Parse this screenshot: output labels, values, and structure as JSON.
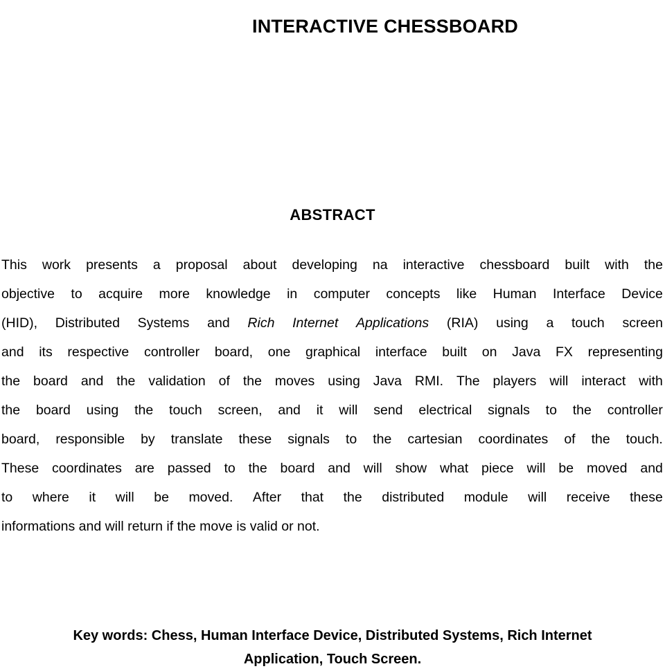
{
  "document": {
    "title": "INTERACTIVE CHESSBOARD",
    "abstract_heading": "ABSTRACT",
    "background_color": "#ffffff",
    "text_color": "#000000"
  },
  "abstract": {
    "lines": [
      {
        "id": "line-1",
        "text": "This work presents a proposal about developing na interactive chessboard built with the",
        "words": [
          "This",
          "work",
          "presents",
          "a",
          "proposal",
          "about",
          "developing",
          "na",
          "interactive",
          "chessboard",
          "built",
          "with",
          "the"
        ]
      },
      {
        "id": "line-2",
        "text": "objective to acquire more knowledge in computer concepts like Human Interface Device",
        "words": [
          "objective",
          "to",
          "acquire",
          "more",
          "knowledge",
          "in",
          "computer",
          "concepts",
          "like",
          "Human",
          "Interface",
          "Device"
        ]
      },
      {
        "id": "line-3",
        "text": "(HID), Distributed Systems and Rich Internet Applications (RIA) using a touch screen",
        "words": [
          "(HID),",
          "Distributed",
          "Systems",
          "and",
          "Rich",
          "Internet",
          "Applications",
          "(RIA)",
          "using",
          "a",
          "touch",
          "screen"
        ],
        "italic_words": [
          "Rich",
          "Internet",
          "Applications"
        ],
        "italic_phrase": "Rich Internet Applications"
      },
      {
        "id": "line-4",
        "text": "and its respective controller board, one graphical interface built on Java FX representing",
        "words": [
          "and",
          "its",
          "respective",
          "controller",
          "board,",
          "one",
          "graphical",
          "interface",
          "built",
          "on",
          "Java",
          "FX",
          "representing"
        ]
      },
      {
        "id": "line-5",
        "text": "the board and the validation of the moves using Java RMI. The players will interact with",
        "words": [
          "the",
          "board",
          "and",
          "the",
          "validation",
          "of",
          "the",
          "moves",
          "using",
          "Java",
          "RMI.",
          "The",
          "players",
          "will",
          "interact",
          "with"
        ]
      },
      {
        "id": "line-6",
        "text": "the board using the touch screen, and it will send electrical signals to the controller",
        "words": [
          "the",
          "board",
          "using",
          "the",
          "touch",
          "screen,",
          "and",
          "it",
          "will",
          "send",
          "electrical",
          "signals",
          "to",
          "the",
          "controller"
        ]
      },
      {
        "id": "line-7",
        "text": "board, responsible by translate these signals to the cartesian coordinates of the touch.",
        "words": [
          "board,",
          "responsible",
          "by",
          "translate",
          "these",
          "signals",
          "to",
          "the",
          "cartesian",
          "coordinates",
          "of",
          "the",
          "touch."
        ]
      },
      {
        "id": "line-8",
        "text": "These coordinates are passed to the board and will show what piece will be moved and",
        "words": [
          "These",
          "coordinates",
          "are",
          "passed",
          "to",
          "the",
          "board",
          "and",
          "will",
          "show",
          "what",
          "piece",
          "will",
          "be",
          "moved",
          "and"
        ]
      },
      {
        "id": "line-9",
        "text": "to where it will be moved. After that the distributed module will receive these",
        "words": [
          "to",
          "where",
          "it",
          "will",
          "be",
          "moved.",
          "After",
          "that",
          "the",
          "distributed",
          "module",
          "will",
          "receive",
          "these"
        ]
      },
      {
        "id": "line-10",
        "text": "informations and will return if the move is valid or not.",
        "words": [
          "informations",
          "and",
          "will",
          "return",
          "if",
          "the",
          "move",
          "is",
          "valid",
          "or",
          "not."
        ]
      }
    ],
    "full_text": "This work presents a proposal about developing na interactive chessboard built with the objective to acquire more knowledge in computer concepts like Human Interface Device (HID), Distributed Systems and Rich Internet Applications (RIA) using a touch screen and its respective controller board, one graphical interface built on Java FX representing the board and the validation of the moves using Java RMI. The players will interact with the board using the touch screen, and it will send electrical signals to the controller board, responsible by translate these signals to the cartesian coordinates of the touch. These coordinates are passed to the board and will show what piece will be moved and to where it will be moved. After that the distributed module will receive these informations and will return if the move is valid or not."
  },
  "keywords": {
    "label": "Key words:",
    "line_1": "Key words: Chess, Human Interface Device, Distributed Systems, Rich Internet",
    "line_2": "Application, Touch Screen.",
    "terms": [
      "Chess",
      "Human Interface Device",
      "Distributed Systems",
      "Rich Internet Application",
      "Touch Screen"
    ]
  }
}
